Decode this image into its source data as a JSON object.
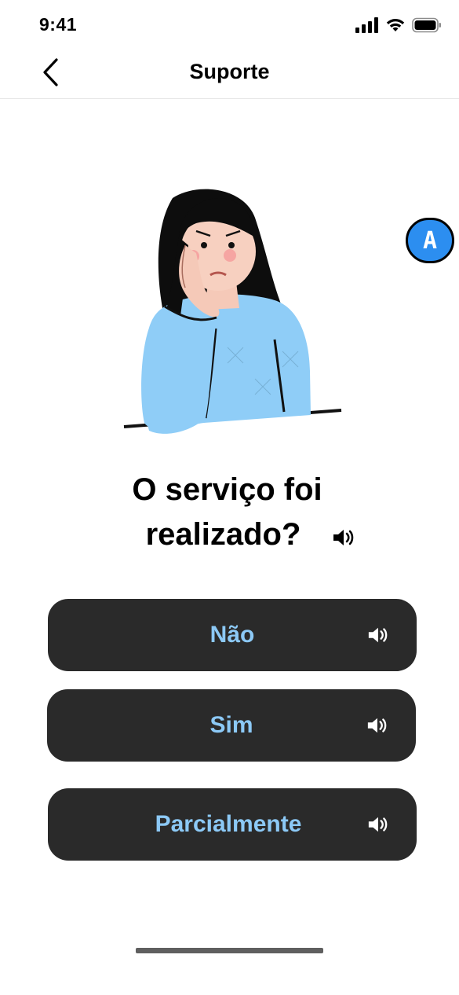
{
  "status_bar": {
    "time": "9:41"
  },
  "nav": {
    "title": "Suporte"
  },
  "accessibility_badge": {
    "label": "A"
  },
  "question": {
    "line1": "O serviço foi",
    "line2": "realizado?"
  },
  "answers": [
    {
      "label": "Não"
    },
    {
      "label": "Sim"
    },
    {
      "label": "Parcialmente"
    }
  ],
  "colors": {
    "button_bg": "#2a2a2a",
    "button_text": "#8cc9f6",
    "badge_bg": "#2c8ef0",
    "sweater": "#8fcdf7"
  },
  "icons": [
    "signal-icon",
    "wifi-icon",
    "battery-icon",
    "back-chevron-icon",
    "speaker-icon"
  ]
}
